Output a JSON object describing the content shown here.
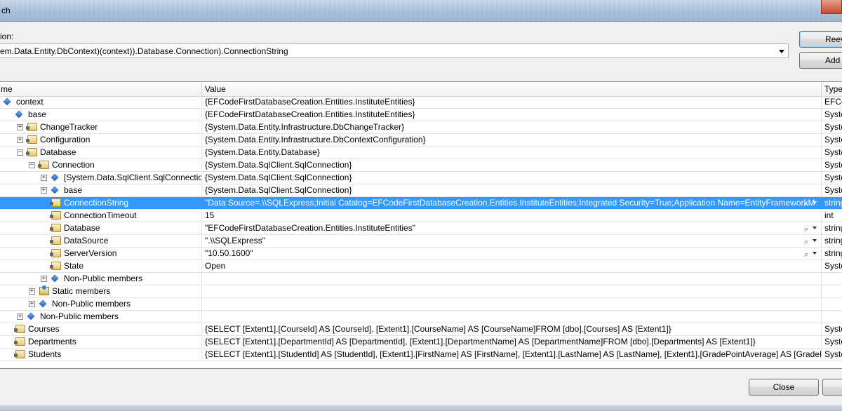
{
  "window": {
    "title": "ch"
  },
  "expression": {
    "label": "ion:",
    "value": "em.Data.Entity.DbContext)(context)).Database.Connection).ConnectionString"
  },
  "buttons": {
    "reevaluate": "Reev",
    "add_watch": "Add",
    "close": "Close"
  },
  "grid": {
    "headers": {
      "name": "me",
      "value": "Value",
      "type": "Type"
    },
    "rows": [
      {
        "name": "context",
        "value": "{EFCodeFirstDatabaseCreation.Entities.InstituteEntities}",
        "type": "EFCo",
        "indent": 0,
        "expander": "",
        "icon": "field"
      },
      {
        "name": "base",
        "value": "{EFCodeFirstDatabaseCreation.Entities.InstituteEntities}",
        "type": "Syste",
        "indent": 1,
        "expander": "",
        "icon": "field"
      },
      {
        "name": "ChangeTracker",
        "value": "{System.Data.Entity.Infrastructure.DbChangeTracker}",
        "type": "Syste",
        "indent": 2,
        "expander": "+",
        "icon": "prop"
      },
      {
        "name": "Configuration",
        "value": "{System.Data.Entity.Infrastructure.DbContextConfiguration}",
        "type": "Syste",
        "indent": 2,
        "expander": "+",
        "icon": "prop"
      },
      {
        "name": "Database",
        "value": "{System.Data.Entity.Database}",
        "type": "Syste",
        "indent": 2,
        "expander": "−",
        "icon": "prop"
      },
      {
        "name": "Connection",
        "value": "{System.Data.SqlClient.SqlConnection}",
        "type": "Syste",
        "indent": 3,
        "expander": "−",
        "icon": "prop"
      },
      {
        "name": "[System.Data.SqlClient.SqlConnection]",
        "value": "{System.Data.SqlClient.SqlConnection}",
        "type": "Syste",
        "indent": 4,
        "expander": "+",
        "icon": "field"
      },
      {
        "name": "base",
        "value": "{System.Data.SqlClient.SqlConnection}",
        "type": "Syste",
        "indent": 4,
        "expander": "+",
        "icon": "field"
      },
      {
        "name": "ConnectionString",
        "value": "\"Data Source=.\\\\SQLExpress;Initial Catalog=EFCodeFirstDatabaseCreation.Entities.InstituteEntities;Integrated Security=True;Application Name=EntityFrameworkM",
        "type": "string",
        "indent": 4,
        "expander": "",
        "icon": "prop",
        "selected": true,
        "viz": true
      },
      {
        "name": "ConnectionTimeout",
        "value": "15",
        "type": "int",
        "indent": 4,
        "expander": "",
        "icon": "prop"
      },
      {
        "name": "Database",
        "value": "\"EFCodeFirstDatabaseCreation.Entities.InstituteEntities\"",
        "type": "string",
        "indent": 4,
        "expander": "",
        "icon": "prop",
        "viz": true
      },
      {
        "name": "DataSource",
        "value": "\".\\\\SQLExpress\"",
        "type": "string",
        "indent": 4,
        "expander": "",
        "icon": "prop",
        "viz": true
      },
      {
        "name": "ServerVersion",
        "value": "\"10.50.1600\"",
        "type": "string",
        "indent": 4,
        "expander": "",
        "icon": "prop",
        "viz": true
      },
      {
        "name": "State",
        "value": "Open",
        "type": "Syste",
        "indent": 4,
        "expander": "",
        "icon": "prop"
      },
      {
        "name": "Non-Public members",
        "value": "",
        "type": "",
        "indent": 4,
        "expander": "+",
        "icon": "field"
      },
      {
        "name": "Static members",
        "value": "",
        "type": "",
        "indent": 3,
        "expander": "+",
        "icon": "static"
      },
      {
        "name": "Non-Public members",
        "value": "",
        "type": "",
        "indent": 3,
        "expander": "+",
        "icon": "field"
      },
      {
        "name": "Non-Public members",
        "value": "",
        "type": "",
        "indent": 2,
        "expander": "+",
        "icon": "field"
      },
      {
        "name": "Courses",
        "value": "{SELECT [Extent1].[CourseId] AS [CourseId], [Extent1].[CourseName] AS [CourseName]FROM [dbo].[Courses] AS [Extent1]}",
        "type": "Syste",
        "indent": 1,
        "expander": "",
        "icon": "prop"
      },
      {
        "name": "Departments",
        "value": "{SELECT [Extent1].[DepartmentId] AS [DepartmentId], [Extent1].[DepartmentName] AS [DepartmentName]FROM [dbo].[Departments] AS [Extent1]}",
        "type": "Syste",
        "indent": 1,
        "expander": "",
        "icon": "prop"
      },
      {
        "name": "Students",
        "value": "{SELECT [Extent1].[StudentId] AS [StudentId], [Extent1].[FirstName] AS [FirstName], [Extent1].[LastName] AS [LastName], [Extent1].[GradePointAverage] AS [GradePoint",
        "type": "Syste",
        "indent": 1,
        "expander": "",
        "icon": "prop"
      }
    ]
  }
}
